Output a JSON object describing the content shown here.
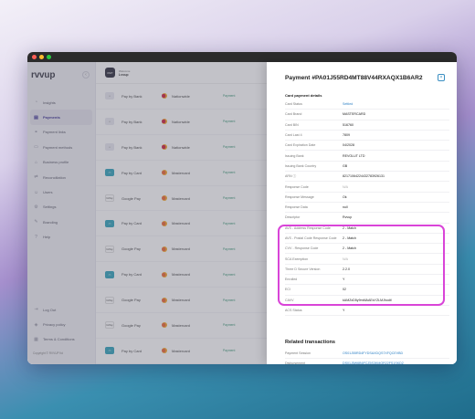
{
  "logo": "rvvup",
  "header": {
    "avatar": "RVP",
    "welcome": "Welcome",
    "user": "Lvvup"
  },
  "sidebar": {
    "items": [
      {
        "icon": "chart-icon",
        "glyph": "◔",
        "label": "Insights",
        "active": false
      },
      {
        "icon": "payments-icon",
        "glyph": "▤",
        "label": "Payments",
        "active": true
      },
      {
        "icon": "link-icon",
        "glyph": "⚭",
        "label": "Payment links",
        "active": false
      },
      {
        "icon": "card-icon",
        "glyph": "▭",
        "label": "Payment methods",
        "active": false
      },
      {
        "icon": "store-icon",
        "glyph": "⌂",
        "label": "Business profile",
        "active": false
      },
      {
        "icon": "reconciliation-icon",
        "glyph": "⇄",
        "label": "Reconciliation",
        "active": false
      },
      {
        "icon": "users-icon",
        "glyph": "☺",
        "label": "Users",
        "active": false
      },
      {
        "icon": "gear-icon",
        "glyph": "⚙",
        "label": "Settings",
        "active": false
      },
      {
        "icon": "branding-icon",
        "glyph": "✎",
        "label": "Branding",
        "active": false
      },
      {
        "icon": "help-icon",
        "glyph": "?",
        "label": "Help",
        "active": false
      }
    ],
    "bottom": [
      {
        "icon": "logout-icon",
        "glyph": "⇥",
        "label": "Log Out"
      },
      {
        "icon": "shield-icon",
        "glyph": "◈",
        "label": "Privacy policy"
      },
      {
        "icon": "document-icon",
        "glyph": "▦",
        "label": "Terms & Conditions"
      }
    ],
    "copyright": "Copyright © RVVUP ltd"
  },
  "rows": [
    {
      "method": "Pay by Bank",
      "icon_text": "⌂",
      "icon_bg": "#e6e6ee",
      "icon_fg": "#555",
      "provider": "Nationwide",
      "prov_color": "#c8102e",
      "status": "Payment"
    },
    {
      "method": "Pay by Bank",
      "icon_text": "⌂",
      "icon_bg": "#e6e6ee",
      "icon_fg": "#555",
      "provider": "Nationwide",
      "prov_color": "#c8102e",
      "status": "Payment"
    },
    {
      "method": "Pay by Bank",
      "icon_text": "⌂",
      "icon_bg": "#e6e6ee",
      "icon_fg": "#555",
      "provider": "Nationwide",
      "prov_color": "#c8102e",
      "status": "Payment"
    },
    {
      "method": "Pay by Card",
      "icon_text": "▭",
      "icon_bg": "#1f9bb5",
      "icon_fg": "#fff",
      "provider": "Mastercard",
      "prov_color": "#eb5a24",
      "status": "Payment"
    },
    {
      "method": "Google Pay",
      "icon_text": "GPay",
      "icon_bg": "#ffffff",
      "icon_fg": "#444",
      "provider": "Mastercard",
      "prov_color": "#eb5a24",
      "status": "Payment"
    },
    {
      "method": "Pay by Card",
      "icon_text": "▭",
      "icon_bg": "#1f9bb5",
      "icon_fg": "#fff",
      "provider": "Mastercard",
      "prov_color": "#eb5a24",
      "status": "Payment"
    },
    {
      "method": "Google Pay",
      "icon_text": "GPay",
      "icon_bg": "#ffffff",
      "icon_fg": "#444",
      "provider": "Mastercard",
      "prov_color": "#eb5a24",
      "status": "Payment"
    },
    {
      "method": "Pay by Card",
      "icon_text": "▭",
      "icon_bg": "#1f9bb5",
      "icon_fg": "#fff",
      "provider": "Mastercard",
      "prov_color": "#eb5a24",
      "status": "Payment"
    },
    {
      "method": "Google Pay",
      "icon_text": "GPay",
      "icon_bg": "#ffffff",
      "icon_fg": "#444",
      "provider": "Mastercard",
      "prov_color": "#eb5a24",
      "status": "Payment"
    },
    {
      "method": "Google Pay",
      "icon_text": "GPay",
      "icon_bg": "#ffffff",
      "icon_fg": "#444",
      "provider": "Mastercard",
      "prov_color": "#eb5a24",
      "status": "Payment"
    },
    {
      "method": "Pay by Card",
      "icon_text": "▭",
      "icon_bg": "#1f9bb5",
      "icon_fg": "#fff",
      "provider": "Mastercard",
      "prov_color": "#eb5a24",
      "status": "Payment"
    },
    {
      "method": "Pay by Card",
      "icon_text": "▭",
      "icon_bg": "#1f9bb5",
      "icon_fg": "#fff",
      "provider": "Mastercard",
      "prov_color": "#eb5a24",
      "status": "Payment"
    }
  ],
  "panel": {
    "title": "Payment #PA01J55RD4MT88V44RXAQX1B6AR2",
    "close": "×",
    "section": "Card payment details",
    "details": [
      {
        "k": "Card Status",
        "v": "Settled",
        "style": "link"
      },
      {
        "k": "Card Brand",
        "v": "MASTERCARD",
        "style": ""
      },
      {
        "k": "Card BIN",
        "v": "516760",
        "style": ""
      },
      {
        "k": "Card Last 4",
        "v": "7809",
        "style": ""
      },
      {
        "k": "Card Expiration Date",
        "v": "04/2028",
        "style": ""
      },
      {
        "k": "Issuing Bank",
        "v": "REVOLUT LTD",
        "style": ""
      },
      {
        "k": "Issuing Bank Country",
        "v": "GB",
        "style": ""
      },
      {
        "k": "ARN ⓘ",
        "v": "82171064224432783926131",
        "style": ""
      },
      {
        "k": "Response Code",
        "v": "N/A",
        "style": "na"
      },
      {
        "k": "Response Message",
        "v": "Ok",
        "style": ""
      },
      {
        "k": "Response Data",
        "v": "null",
        "style": ""
      },
      {
        "k": "Descriptor",
        "v": "Rvvup",
        "style": ""
      },
      {
        "k": "AVS - Address Response Code",
        "v": "2 - Match",
        "style": ""
      },
      {
        "k": "AVS - Postal Code Response Code",
        "v": "2 - Match",
        "style": ""
      },
      {
        "k": "CVV - Response Code",
        "v": "2 - Match",
        "style": ""
      },
      {
        "k": "SCA Exemption",
        "v": "N/A",
        "style": "na"
      },
      {
        "k": "Three D Secure Version",
        "v": "2.2.0",
        "style": ""
      },
      {
        "k": "Enrolled",
        "v": "Y",
        "style": ""
      },
      {
        "k": "ECI",
        "v": "02",
        "style": ""
      },
      {
        "k": "CAVV",
        "v": "kAMZxD5y9mMAAEsYZLMJhodt/",
        "style": ""
      },
      {
        "k": "ACS Status",
        "v": "Y",
        "style": ""
      }
    ],
    "related_title": "Related transactions",
    "related": [
      {
        "k": "Payment Session",
        "v": "OS01J55RD4FYDSAXDQS7XFQCEVBD"
      },
      {
        "k": "Disbursement",
        "v": "DS01J5W6B6FCZ5S3KMQR22FS1SKD2"
      }
    ]
  },
  "colors": {
    "accent": "#2c1f8a",
    "highlight": "#d944d8",
    "link": "#2b7fc4"
  }
}
